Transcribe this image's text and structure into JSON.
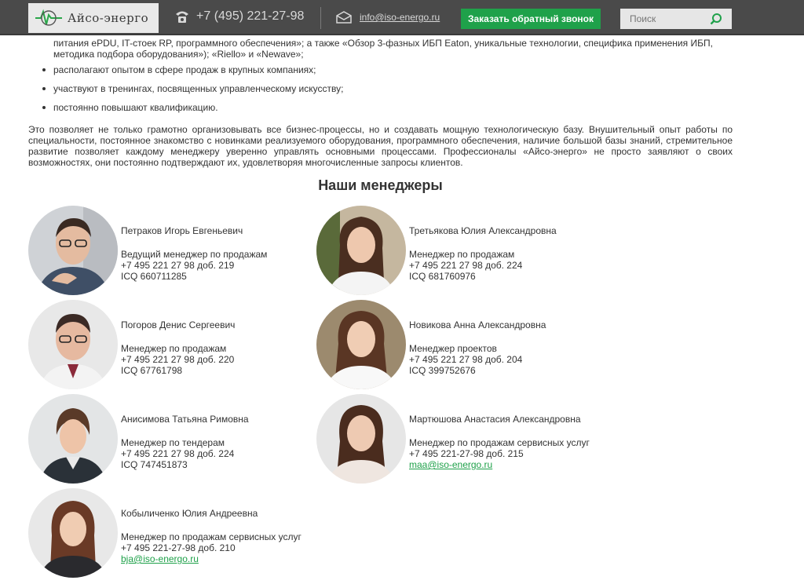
{
  "header": {
    "logo_text": "Айсо-энерго",
    "phone": "+7 (495) 221-27-98",
    "email": "info@iso-energo.ru",
    "callback_label": "Заказать обратный звонок",
    "search_placeholder": "Поиск"
  },
  "content": {
    "continued_text": "питания ePDU, IT-стоек RP, программного обеспечения»; а также «Обзор 3-фазных ИБП Eaton, уникальные технологии, специфика применения ИБП, методика подбора оборудования»); «Riello» и «Newave»;",
    "bullets": [
      "располагают опытом в сфере продаж в крупных компаниях;",
      "участвуют в тренингах, посвященных управленческому искусству;",
      "постоянно повышают квалификацию."
    ],
    "intro": "Это позволяет не только грамотно организовывать все бизнес-процессы, но и создавать мощную технологическую базу. Внушительный опыт работы по специальности, постоянное знакомство с новинками реализуемого оборудования, программного обеспечения, наличие большой базы знаний, стремительное развитие позволяет каждому менеджеру уверенно управлять основными процессами. Профессионалы «Айсо-энерго» не просто заявляют о своих возможностях, они постоянно подтверждают их, удовлетворяя многочисленные запросы клиентов.",
    "section_title": "Наши менеджеры"
  },
  "managers": [
    {
      "name": "Петраков Игорь Евгеньевич",
      "position": "Ведущий менеджер по продажам",
      "phone": "+7 495 221 27 98 доб. 219",
      "contact": "ICQ 660711285"
    },
    {
      "name": "Третьякова Юлия Александровна",
      "position": "Менеджер по продажам",
      "phone": "+7 495 221 27 98 доб. 224",
      "contact": "ICQ 681760976"
    },
    {
      "name": "Погоров Денис Сергеевич",
      "position": "Менеджер по продажам",
      "phone": "+7 495 221 27 98 доб. 220",
      "contact": "ICQ 67761798"
    },
    {
      "name": "Новикова Анна Александровна",
      "position": "Менеджер проектов",
      "phone": "+7 495 221 27 98 доб. 204",
      "contact": "ICQ 399752676"
    },
    {
      "name": "Анисимова Татьяна Римовна",
      "position": "Менеджер по тендерам",
      "phone": "+7 495 221 27 98 доб. 224",
      "contact": "ICQ 747451873"
    },
    {
      "name": "Мартюшова Анастасия Александровна",
      "position": "Менеджер по продажам сервисных услуг",
      "phone": "+7 495 221-27-98 доб. 215",
      "email": "maa@iso-energo.ru"
    },
    {
      "name": "Кобыличенко Юлия Андреевна",
      "position": "Менеджер по продажам сервисных услуг",
      "phone": "+7 495 221-27-98 доб. 210",
      "email": "bja@iso-energo.ru"
    }
  ],
  "colors": {
    "header_bg": "#4a4a4a",
    "accent": "#1fa14a",
    "text": "#333333"
  }
}
